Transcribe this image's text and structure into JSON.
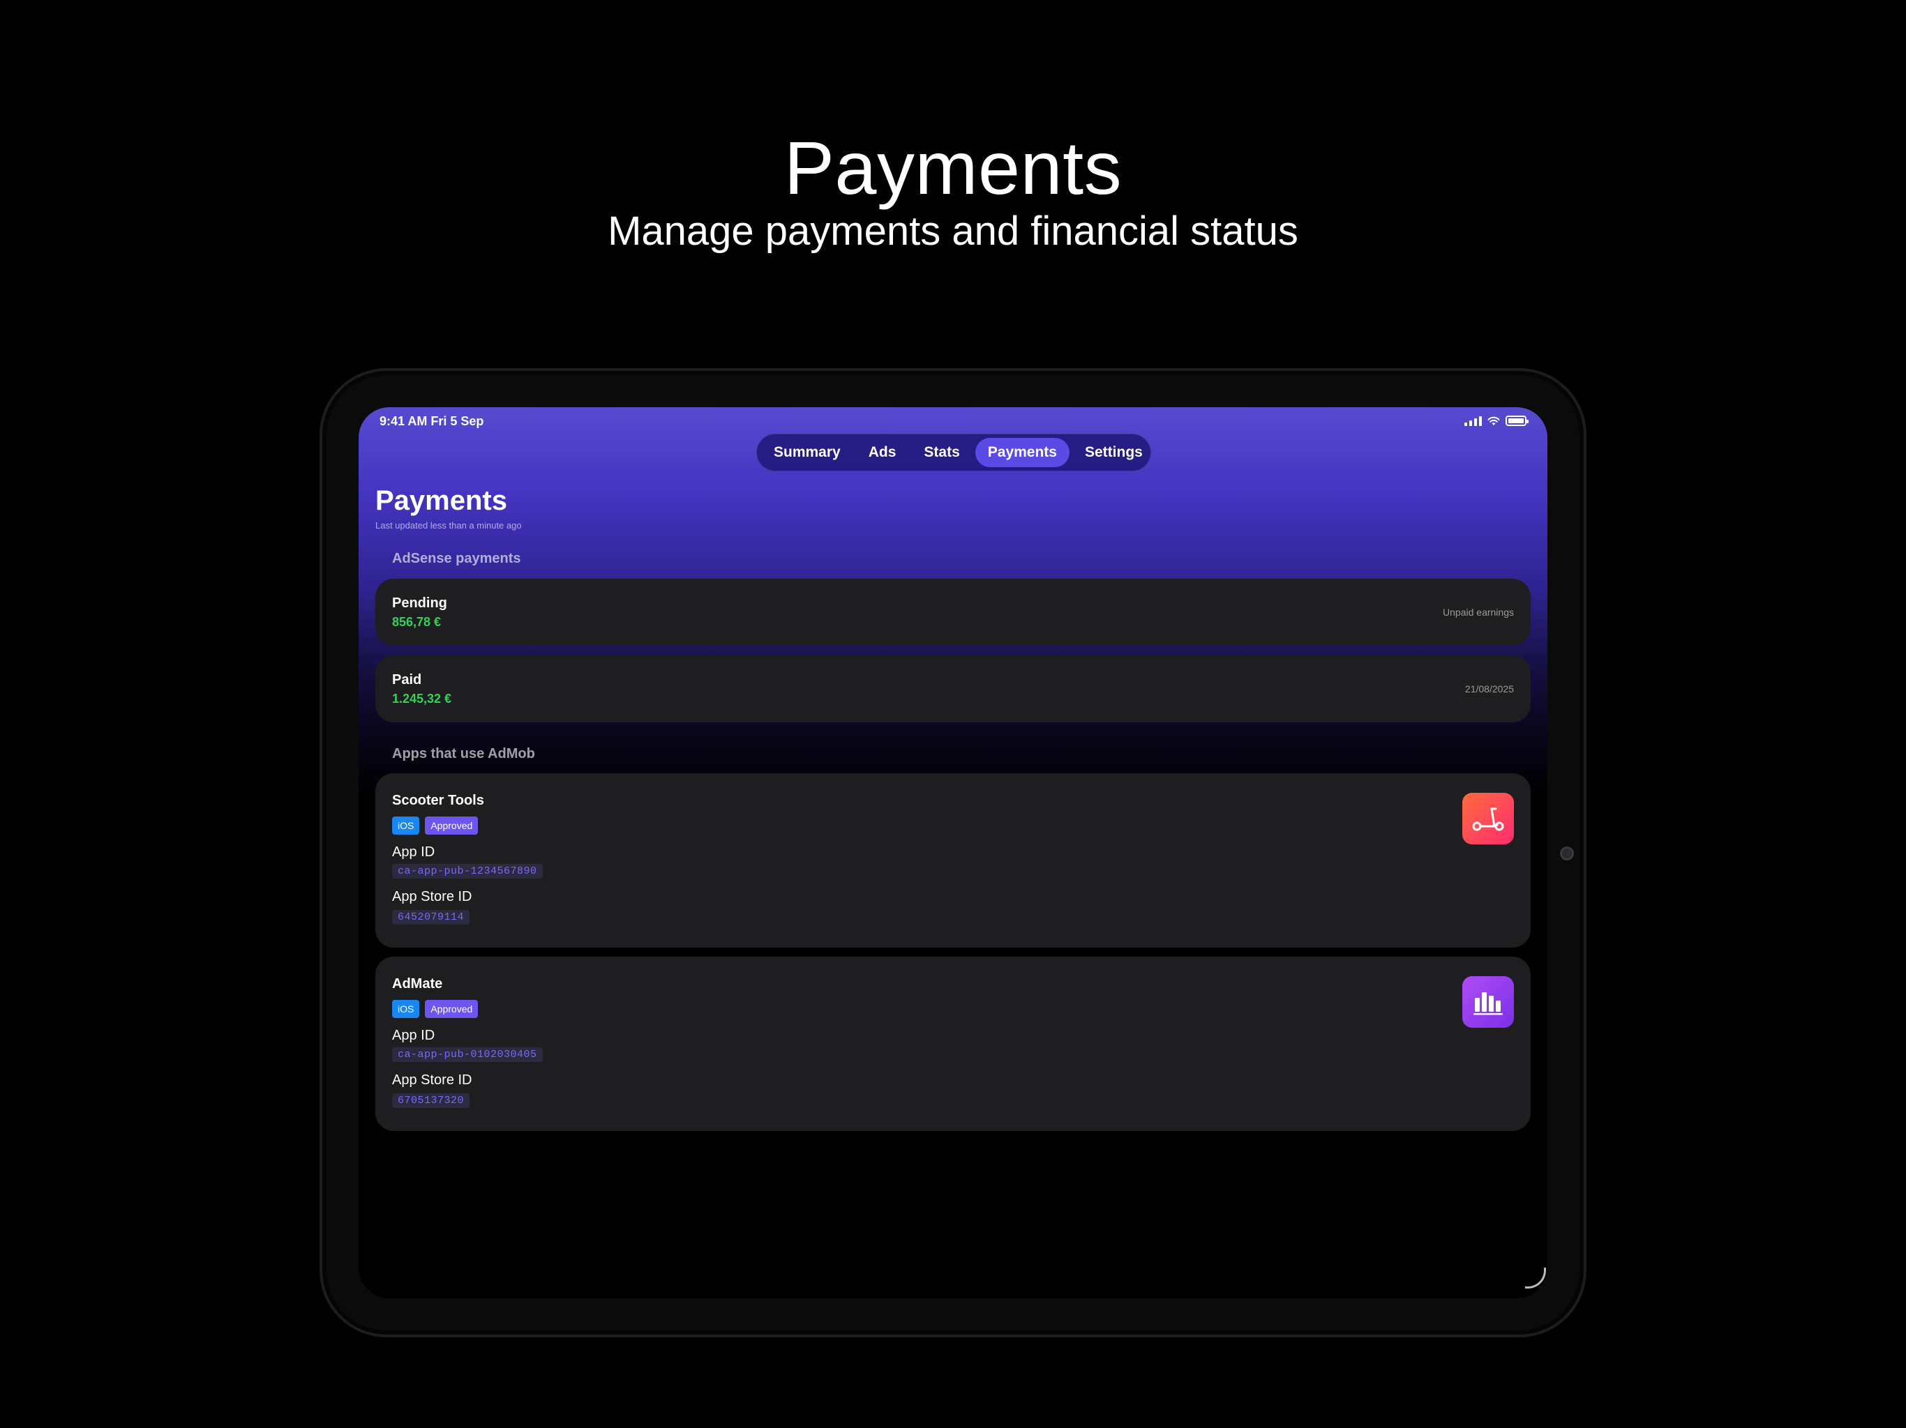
{
  "promo": {
    "headline": "Payments",
    "subheadline": "Manage payments and financial status"
  },
  "statusbar": {
    "time": "9:41 AM   Fri 5 Sep"
  },
  "tabs": [
    {
      "label": "Summary",
      "active": false
    },
    {
      "label": "Ads",
      "active": false
    },
    {
      "label": "Stats",
      "active": false
    },
    {
      "label": "Payments",
      "active": true
    },
    {
      "label": "Settings",
      "active": false
    }
  ],
  "page": {
    "title": "Payments",
    "updated": "Last updated less than a minute ago"
  },
  "adsense": {
    "section_label": "AdSense payments",
    "pending": {
      "title": "Pending",
      "amount": "856,78 €",
      "note": "Unpaid earnings"
    },
    "paid": {
      "title": "Paid",
      "amount": "1.245,32 €",
      "note": "21/08/2025"
    }
  },
  "admob": {
    "section_label": "Apps that use AdMob",
    "apps": [
      {
        "name": "Scooter Tools",
        "platform": "iOS",
        "status": "Approved",
        "app_id_label": "App ID",
        "app_id": "ca-app-pub-1234567890",
        "store_id_label": "App Store ID",
        "store_id": "6452079114",
        "icon": "scooter-icon"
      },
      {
        "name": "AdMate",
        "platform": "iOS",
        "status": "Approved",
        "app_id_label": "App ID",
        "app_id": "ca-app-pub-0102030405",
        "store_id_label": "App Store ID",
        "store_id": "6705137320",
        "icon": "bar-chart-icon"
      }
    ]
  },
  "colors": {
    "accent": "#5a4ae6",
    "amount_green": "#35d158",
    "ios_badge": "#1a87f0",
    "approved_badge": "#6d55f0"
  }
}
